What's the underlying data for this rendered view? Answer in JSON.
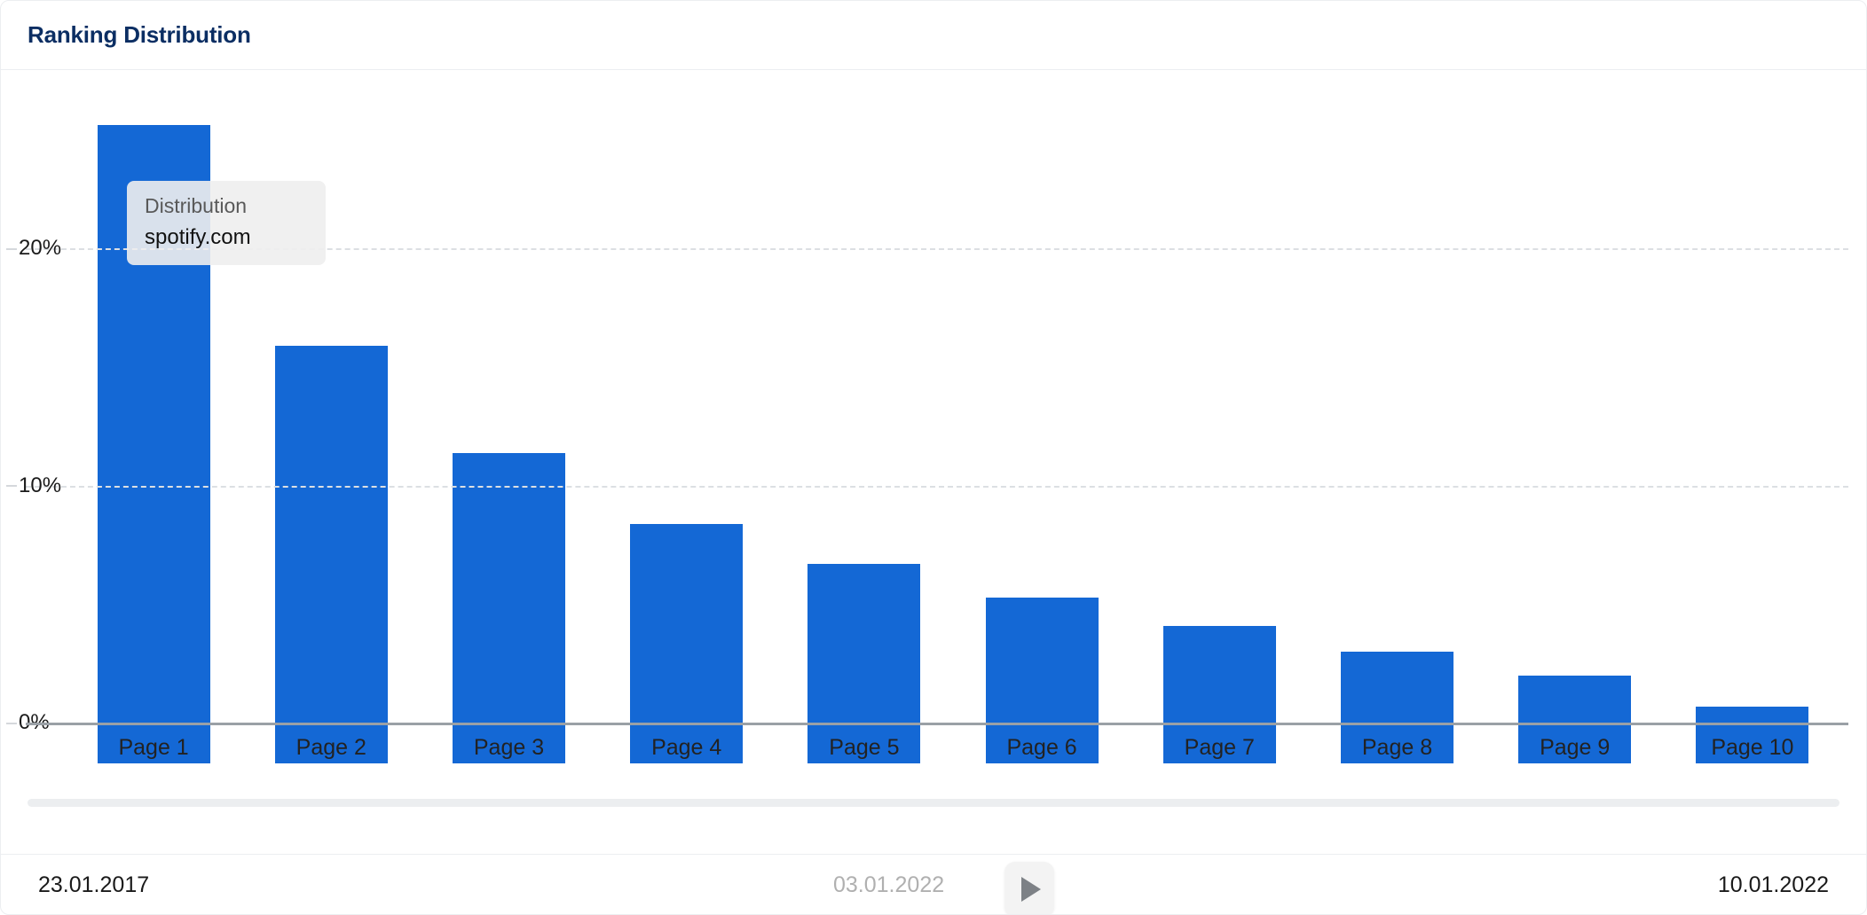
{
  "header": {
    "title": "Ranking Distribution"
  },
  "tooltip": {
    "label": "Distribution",
    "value": "spotify.com"
  },
  "timeline": {
    "start_date": "23.01.2017",
    "current_date": "03.01.2022",
    "end_date": "10.01.2022",
    "play_icon": "play-icon"
  },
  "colors": {
    "bar": "#1468d5",
    "title": "#0b2e63",
    "gridline": "#dcdfe3",
    "axis": "#9aa0a6"
  },
  "chart_data": {
    "type": "bar",
    "title": "Ranking Distribution",
    "xlabel": "",
    "ylabel": "",
    "categories": [
      "Page 1",
      "Page 2",
      "Page 3",
      "Page 4",
      "Page 5",
      "Page 6",
      "Page 7",
      "Page 8",
      "Page 9",
      "Page 10"
    ],
    "values": [
      26.9,
      17.6,
      13.1,
      10.1,
      8.4,
      7.0,
      5.8,
      4.7,
      3.7,
      2.4
    ],
    "series": [
      {
        "name": "Distribution",
        "values": [
          26.9,
          17.6,
          13.1,
          10.1,
          8.4,
          7.0,
          5.8,
          4.7,
          3.7,
          2.4
        ]
      }
    ],
    "y_ticks": [
      "0%",
      "10%",
      "20%"
    ],
    "y_tick_values": [
      0,
      10,
      20
    ],
    "ylim": [
      0,
      27
    ],
    "grid": true,
    "legend_position": "none",
    "value_unit": "%"
  }
}
